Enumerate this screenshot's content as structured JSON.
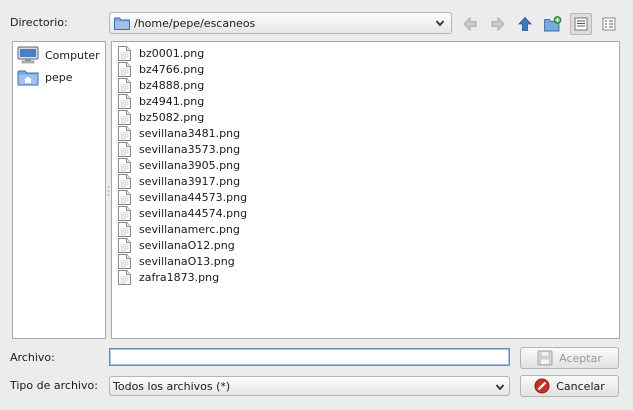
{
  "directory": {
    "label": "Directorio:",
    "path": "/home/pepe/escaneos"
  },
  "toolbar": {
    "back_icon": "back-arrow-icon",
    "forward_icon": "forward-arrow-icon",
    "up_icon": "up-arrow-icon",
    "new_folder_icon": "new-folder-icon",
    "icon_view_icon": "icon-view-icon",
    "list_view_icon": "list-view-icon"
  },
  "places": [
    {
      "label": "Computer",
      "icon": "computer-icon"
    },
    {
      "label": "pepe",
      "icon": "home-folder-icon"
    }
  ],
  "files": [
    "bz0001.png",
    "bz4766.png",
    "bz4888.png",
    "bz4941.png",
    "bz5082.png",
    "sevillana3481.png",
    "sevillana3573.png",
    "sevillana3905.png",
    "sevillana3917.png",
    "sevillana44573.png",
    "sevillana44574.png",
    "sevillanamerc.png",
    "sevillanaO12.png",
    "sevillanaO13.png",
    "zafra1873.png"
  ],
  "archivo": {
    "label": "Archivo:",
    "value": ""
  },
  "tipo": {
    "label": "Tipo de archivo:",
    "selected": "Todos los archivos (*)"
  },
  "buttons": {
    "accept": "Aceptar",
    "cancel": "Cancelar"
  },
  "colors": {
    "accent": "#3b78c4",
    "cancel_icon": "#c8302a"
  }
}
